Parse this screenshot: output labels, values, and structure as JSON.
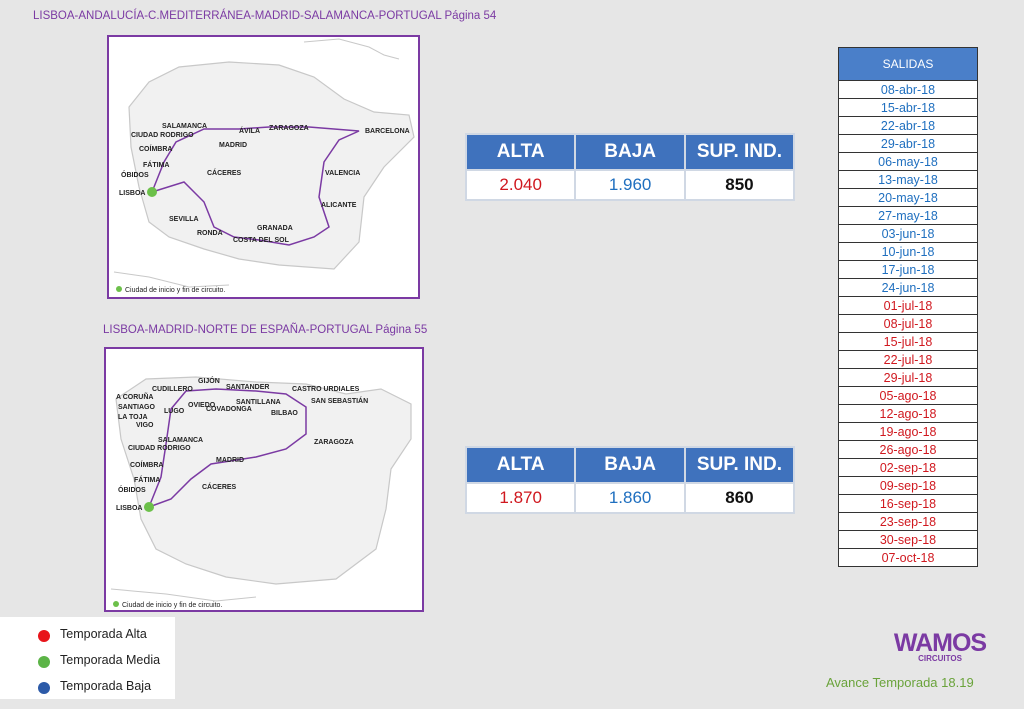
{
  "route1": {
    "title": "LISBOA-ANDALUCÍA-C.MEDITERRÁNEA-MADRID-SALAMANCA-PORTUGAL Página 54",
    "cities": [
      "SALAMANCA",
      "ÁVILA",
      "ZARAGOZA",
      "BARCELONA",
      "CIUDAD RODRIGO",
      "COÍMBRA",
      "MADRID",
      "FÁTIMA",
      "ÓBIDOS",
      "CÁCERES",
      "VALENCIA",
      "LISBOA",
      "ALICANTE",
      "SEVILLA",
      "GRANADA",
      "RONDA",
      "COSTA DEL SOL"
    ],
    "map_footnote": "Ciudad de inicio y fin de circuito.",
    "prices": {
      "headers": [
        "ALTA",
        "BAJA",
        "SUP. IND."
      ],
      "alta": "2.040",
      "baja": "1.960",
      "sup_ind": "850"
    }
  },
  "route2": {
    "title": "LISBOA-MADRID-NORTE DE ESPAÑA-PORTUGAL Página 55",
    "cities": [
      "GIJÓN",
      "CUDILLERO",
      "SANTANDER",
      "CASTRO URDIALES",
      "A CORUÑA",
      "SAN SEBASTIÁN",
      "OVIEDO",
      "SANTILLANA",
      "SANTIAGO",
      "LA TOJA",
      "LUGO",
      "COVADONGA",
      "BILBAO",
      "VIGO",
      "SALAMANCA",
      "ZARAGOZA",
      "CIUDAD RODRIGO",
      "MADRID",
      "COÍMBRA",
      "FÁTIMA",
      "CÁCERES",
      "ÓBIDOS",
      "LISBOA"
    ],
    "map_footnote": "Ciudad de inicio y fin de circuito.",
    "prices": {
      "headers": [
        "ALTA",
        "BAJA",
        "SUP. IND."
      ],
      "alta": "1.870",
      "baja": "1.860",
      "sup_ind": "860"
    }
  },
  "salidas": {
    "header": "SALIDAS",
    "dates": [
      {
        "d": "08-abr-18",
        "s": "baja"
      },
      {
        "d": "15-abr-18",
        "s": "baja"
      },
      {
        "d": "22-abr-18",
        "s": "baja"
      },
      {
        "d": "29-abr-18",
        "s": "baja"
      },
      {
        "d": "06-may-18",
        "s": "baja"
      },
      {
        "d": "13-may-18",
        "s": "baja"
      },
      {
        "d": "20-may-18",
        "s": "baja"
      },
      {
        "d": "27-may-18",
        "s": "baja"
      },
      {
        "d": "03-jun-18",
        "s": "baja"
      },
      {
        "d": "10-jun-18",
        "s": "baja"
      },
      {
        "d": "17-jun-18",
        "s": "baja"
      },
      {
        "d": "24-jun-18",
        "s": "baja"
      },
      {
        "d": "01-jul-18",
        "s": "alta"
      },
      {
        "d": "08-jul-18",
        "s": "alta"
      },
      {
        "d": "15-jul-18",
        "s": "alta"
      },
      {
        "d": "22-jul-18",
        "s": "alta"
      },
      {
        "d": "29-jul-18",
        "s": "alta"
      },
      {
        "d": "05-ago-18",
        "s": "alta"
      },
      {
        "d": "12-ago-18",
        "s": "alta"
      },
      {
        "d": "19-ago-18",
        "s": "alta"
      },
      {
        "d": "26-ago-18",
        "s": "alta"
      },
      {
        "d": "02-sep-18",
        "s": "alta"
      },
      {
        "d": "09-sep-18",
        "s": "alta"
      },
      {
        "d": "16-sep-18",
        "s": "alta"
      },
      {
        "d": "23-sep-18",
        "s": "alta"
      },
      {
        "d": "30-sep-18",
        "s": "alta"
      },
      {
        "d": "07-oct-18",
        "s": "alta"
      }
    ]
  },
  "legend": {
    "items": [
      {
        "label": "Temporada Alta",
        "color": "#e8151b"
      },
      {
        "label": "Temporada Media",
        "color": "#5cb447"
      },
      {
        "label": "Temporada Baja",
        "color": "#2c5aa8"
      }
    ]
  },
  "brand": {
    "logo_text": "WAMOS",
    "logo_sub": "CIRCUITOS",
    "season": "Avance Temporada 18.19"
  },
  "colors": {
    "alta": "#d0181f",
    "baja": "#1f6fbf",
    "header_blue": "#3f72bd",
    "purple": "#7b3aa3",
    "start_city": "#6cc04a"
  }
}
